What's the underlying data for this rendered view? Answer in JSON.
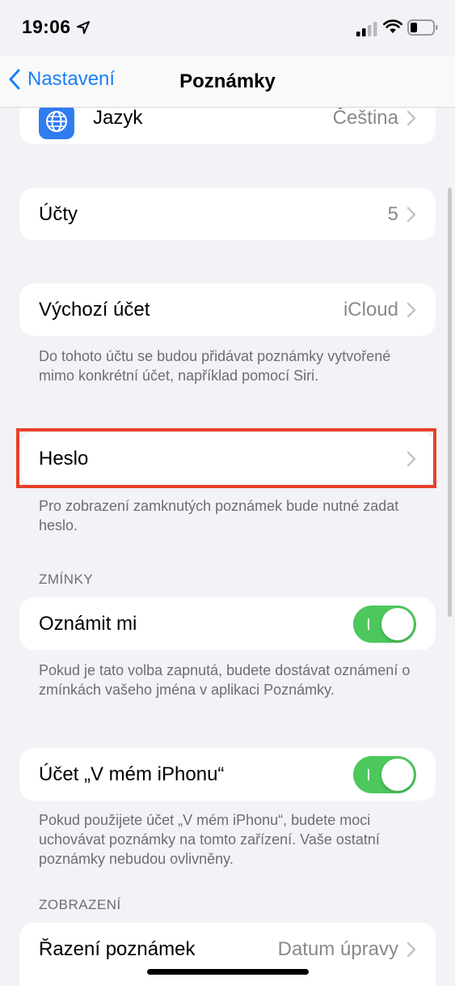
{
  "status": {
    "time": "19:06"
  },
  "nav": {
    "back_label": "Nastavení",
    "title": "Poznámky"
  },
  "rows": {
    "language": {
      "label": "Jazyk",
      "value": "Čeština"
    },
    "accounts": {
      "label": "Účty",
      "value": "5"
    },
    "default_account": {
      "label": "Výchozí účet",
      "value": "iCloud"
    },
    "default_account_footer": "Do tohoto účtu se budou přidávat poznámky vytvořené mimo konkrétní účet, například pomocí Siri.",
    "password": {
      "label": "Heslo"
    },
    "password_footer": "Pro zobrazení zamknutých poznámek bude nutné zadat heslo.",
    "mentions_header": "ZMÍNKY",
    "notify": {
      "label": "Oznámit mi",
      "on": true
    },
    "notify_footer": "Pokud je tato volba zapnutá, budete dostávat oznámení o zmínkách vašeho jména v aplikaci Poznámky.",
    "on_iphone": {
      "label": "Účet „V mém iPhonu“",
      "on": true
    },
    "on_iphone_footer": "Pokud použijete účet „V mém iPhonu“, budete moci uchovávat poznámky na tomto zařízení. Vaše ostatní poznámky nebudou ovlivněny.",
    "display_header": "ZOBRAZENÍ",
    "sort": {
      "label": "Řazení poznámek",
      "value": "Datum úpravy"
    }
  },
  "colors": {
    "accent": "#1a7ff5",
    "toggle_on": "#4cc85c",
    "highlight": "#e8402a"
  }
}
